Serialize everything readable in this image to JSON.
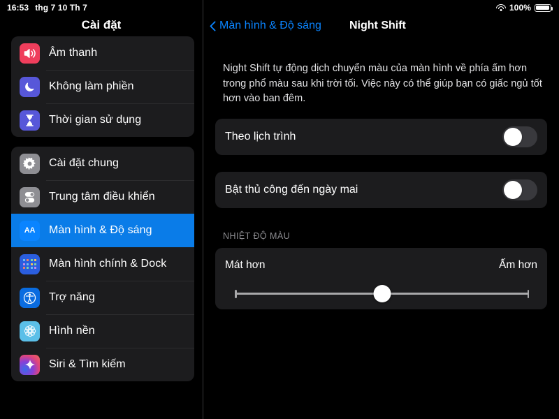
{
  "status_bar": {
    "time": "16:53",
    "date": "thg 7 10 Th 7",
    "wifi_icon": "wifi-icon",
    "battery_percent": "100%",
    "battery_icon": "battery-full-icon"
  },
  "sidebar": {
    "title": "Cài đặt",
    "groups": [
      {
        "items": [
          {
            "label": "Âm thanh",
            "icon": "speaker-icon",
            "selected": false
          },
          {
            "label": "Không làm phiền",
            "icon": "moon-icon",
            "selected": false
          },
          {
            "label": "Thời gian sử dụng",
            "icon": "hourglass-icon",
            "selected": false
          }
        ]
      },
      {
        "items": [
          {
            "label": "Cài đặt chung",
            "icon": "gear-icon",
            "selected": false
          },
          {
            "label": "Trung tâm điều khiển",
            "icon": "toggles-icon",
            "selected": false
          },
          {
            "label": "Màn hình & Độ sáng",
            "icon": "aa-text-icon",
            "selected": true
          },
          {
            "label": "Màn hình chính & Dock",
            "icon": "app-grid-icon",
            "selected": false
          },
          {
            "label": "Trợ năng",
            "icon": "accessibility-icon",
            "selected": false
          },
          {
            "label": "Hình nền",
            "icon": "flower-icon",
            "selected": false
          },
          {
            "label": "Siri & Tìm kiếm",
            "icon": "siri-icon",
            "selected": false
          }
        ]
      }
    ]
  },
  "detail": {
    "back_label": "Màn hình & Độ sáng",
    "back_icon": "chevron-left-icon",
    "title": "Night Shift",
    "description": "Night Shift tự động dịch chuyển màu của màn hình về phía ấm hơn trong phổ màu sau khi trời tối. Việc này có thể giúp bạn có giấc ngủ tốt hơn vào ban đêm.",
    "schedule": {
      "label": "Theo lịch trình",
      "value": "off"
    },
    "manual": {
      "label": "Bật thủ công đến ngày mai",
      "value": "off"
    },
    "temperature": {
      "section_label": "NHIỆT ĐỘ MÀU",
      "left_label": "Mát hơn",
      "right_label": "Ấm hơn",
      "slider_percent": 50
    }
  },
  "colors": {
    "accent_blue": "#0A84FF",
    "selected_row": "#0A7CE8",
    "card_bg": "#1C1C1E",
    "page_bg": "#000000",
    "switch_off_track": "#39393D",
    "section_label": "#8C8C90"
  }
}
